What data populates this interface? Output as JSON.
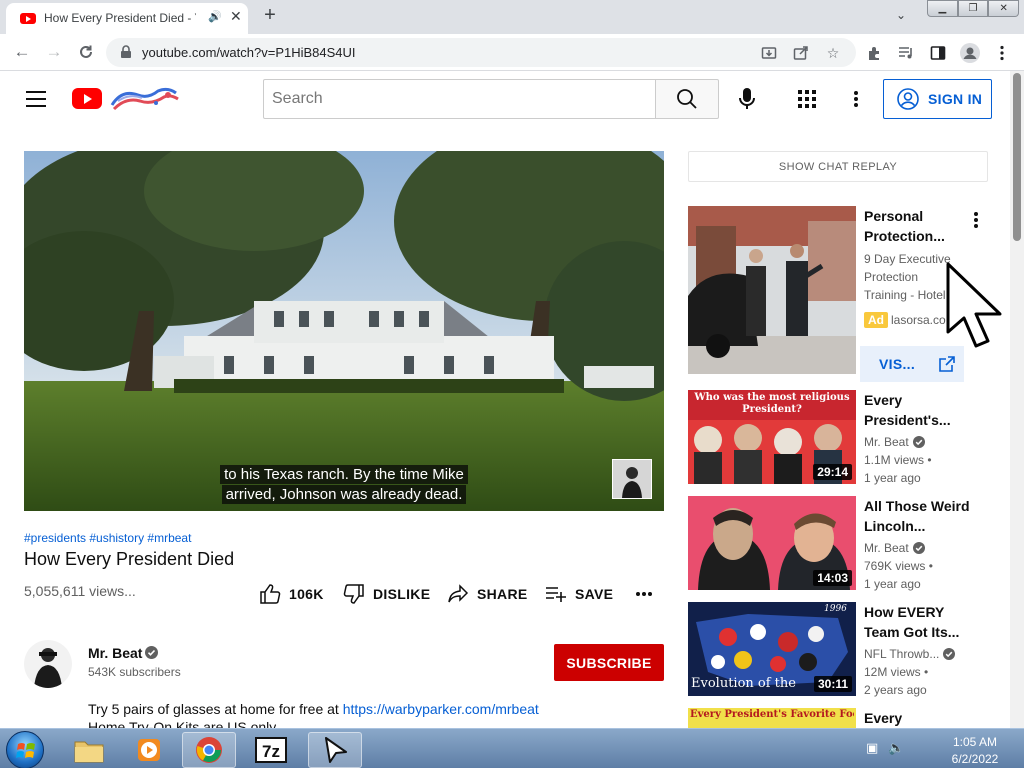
{
  "browser": {
    "tab_title": "How Every President Died - YouTube",
    "url": "youtube.com/watch?v=P1HiB84S4UI"
  },
  "header": {
    "search_placeholder": "Search",
    "sign_in_label": "SIGN IN"
  },
  "player": {
    "caption_line1": "to his Texas ranch. By the time Mike",
    "caption_line2": "arrived, Johnson was already dead."
  },
  "video": {
    "hashtags": "#presidents #ushistory #mrbeat",
    "title": "How Every President Died",
    "views": "5,055,611 views...",
    "like_count": "106K",
    "dislike_label": "DISLIKE",
    "share_label": "SHARE",
    "save_label": "SAVE"
  },
  "channel": {
    "name": "Mr. Beat",
    "subscribers": "543K subscribers",
    "subscribe_label": "SUBSCRIBE"
  },
  "description": {
    "line1_text": "Try 5 pairs of glasses at home for free at ",
    "line1_link": "https://warbyparker.com/mrbeat",
    "line2_text": "Home Try-On Kits are US only"
  },
  "sidebar": {
    "chat_replay_label": "SHOW CHAT REPLAY",
    "ad": {
      "title": "Personal Protection...",
      "description": "9 Day Executive Protection Training - Hotel...",
      "badge": "Ad",
      "domain": "lasorsa.com",
      "visit_label": "VIS..."
    },
    "recommendations": [
      {
        "title": "Every President's...",
        "channel": "Mr. Beat",
        "views": "1.1M views •",
        "age": "1 year ago",
        "duration": "29:14",
        "thumb_text": "Who was the most religious President?"
      },
      {
        "title": "All Those Weird Lincoln...",
        "channel": "Mr. Beat",
        "views": "769K views •",
        "age": "1 year ago",
        "duration": "14:03"
      },
      {
        "title": "How EVERY Team Got Its...",
        "channel": "NFL Throwb...",
        "views": "12M views •",
        "age": "2 years ago",
        "duration": "30:11",
        "thumb_text": "Evolution of the",
        "thumb_text_small": "1996"
      },
      {
        "title": "Every",
        "thumb_text": "Every President's Favorite Food"
      }
    ]
  },
  "taskbar": {
    "time": "1:05 AM",
    "date": "6/2/2022"
  },
  "colors": {
    "youtube_red": "#ff0000",
    "subscribe_red": "#cc0000",
    "link_blue": "#065fd4",
    "ad_yellow": "#f9c83c"
  }
}
